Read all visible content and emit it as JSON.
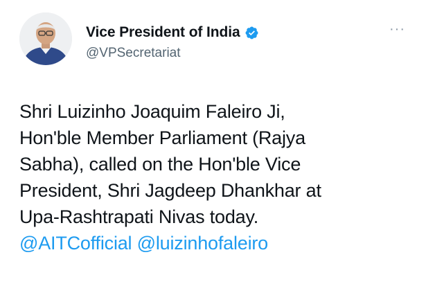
{
  "account": {
    "display_name": "Vice President of India",
    "handle": "@VPSecretariat",
    "verified": true,
    "verified_icon": "verified-badge-icon",
    "verified_color": "#1d9bf0"
  },
  "menu": {
    "more_label": "···"
  },
  "tweet": {
    "lines": [
      "Shri Luizinho Joaquim Faleiro Ji,",
      "Hon'ble Member Parliament (Rajya",
      "Sabha), called on the Hon'ble Vice",
      "President, Shri Jagdeep Dhankhar at",
      "Upa-Rashtrapati Nivas today."
    ],
    "mentions": [
      "@AITCofficial",
      "@luizinhofaleiro"
    ],
    "mention_color": "#1d9bf0"
  }
}
